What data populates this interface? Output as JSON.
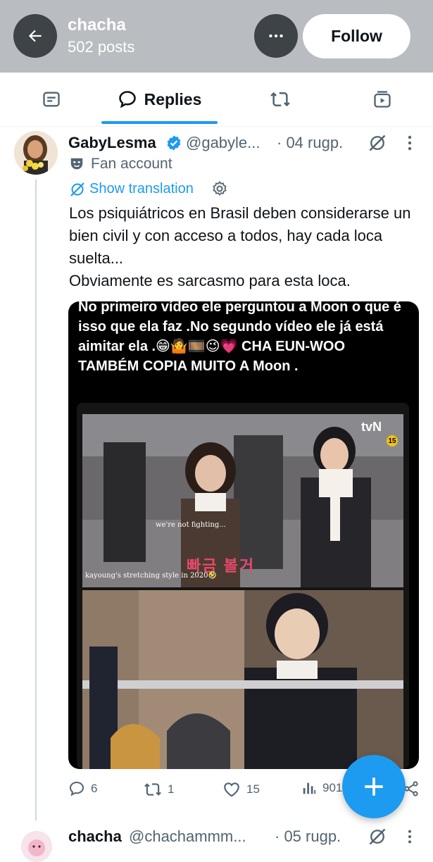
{
  "header": {
    "profile_name": "chacha",
    "posts_count": "502 posts",
    "follow_label": "Follow"
  },
  "tabs": [
    {
      "icon": "posts-icon",
      "label": ""
    },
    {
      "icon": "reply-bubble-icon",
      "label": "Replies",
      "active": true
    },
    {
      "icon": "retweet-icon",
      "label": ""
    },
    {
      "icon": "media-icon",
      "label": ""
    }
  ],
  "tweet": {
    "author_name": "GabyLesma",
    "author_handle": "@gabyle...",
    "time": "· 04 rugp.",
    "fan_label": "Fan account",
    "translate_label": "Show translation",
    "text": "Los psiquiátricos en Brasil deben considerarse un bien civil y con acceso a todos, hay cada loca suelta...\nObviamente  es sarcasmo para esta loca.",
    "media_caption": "No primeiro vídeo ele perguntou a Moon o que é isso que ela faz .No segundo vídeo ele já está aimitar ela .😁🤷🎞️😉💗 CHA EUN-WOO TAMBÉM COPIA MUITO A Moon .",
    "video_subtitle": "we're not fighting...",
    "video_watermark": "kayoung's stretching style in 2020🤣",
    "video_channel": "tvN",
    "actions": {
      "replies": "6",
      "reposts": "1",
      "likes": "15",
      "views": "901"
    }
  },
  "next_tweet": {
    "author_name": "chacha",
    "author_handle": "@chachammm...",
    "time": "· 05 rugp."
  },
  "colors": {
    "accent": "#1d9bf0",
    "header_bg": "#b9bcc0",
    "muted": "#536471"
  }
}
